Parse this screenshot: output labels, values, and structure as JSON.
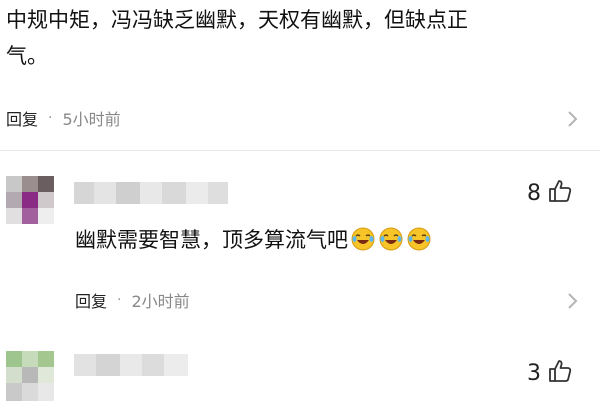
{
  "comments": [
    {
      "text_line1": "中规中矩，冯冯缺乏幽默，天权有幽默，但缺点正",
      "text_line2": "气。",
      "reply_label": "回复",
      "dot": "·",
      "time": "5小时前",
      "more_icon": "chevron-right-icon"
    },
    {
      "avatar": "blurred-avatar",
      "username": "",
      "likes": "8",
      "text": "幽默需要智慧，顶多算流气吧",
      "emojis": [
        "laughing-crying-emoji",
        "laughing-crying-emoji",
        "laughing-crying-emoji"
      ],
      "reply_label": "回复",
      "dot": "·",
      "time": "2小时前",
      "more_icon": "chevron-right-icon"
    },
    {
      "avatar": "blurred-avatar",
      "username": "",
      "likes": "3"
    }
  ],
  "colors": {
    "text": "#111111",
    "meta": "#888888",
    "divider": "#e6e6e6",
    "emoji_face": "#f7c528"
  }
}
